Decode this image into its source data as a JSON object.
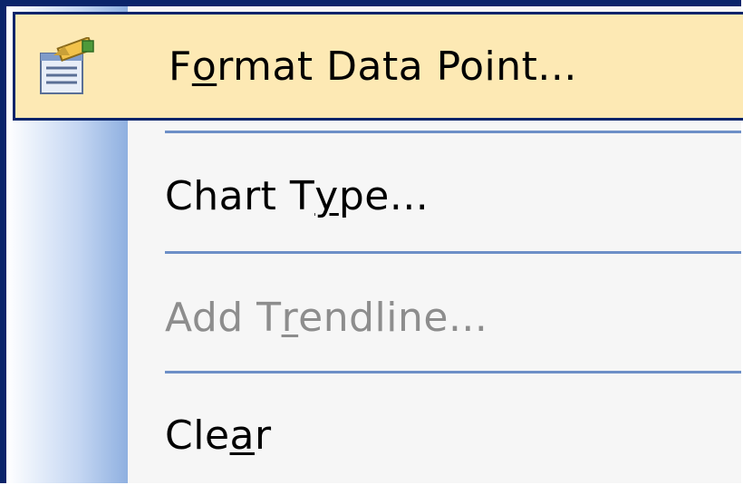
{
  "menu": {
    "items": [
      {
        "pre": "F",
        "ul": "o",
        "post": "rmat Data Point...",
        "enabled": true,
        "highlighted": true,
        "icon": "format-data-point-icon"
      },
      {
        "pre": "Chart T",
        "ul": "y",
        "post": "pe...",
        "enabled": true
      },
      {
        "pre": "Add T",
        "ul": "r",
        "post": "endline...",
        "enabled": false
      },
      {
        "pre": "Cle",
        "ul": "a",
        "post": "r",
        "enabled": true
      }
    ]
  },
  "colors": {
    "highlight_bg": "#fde9b4",
    "highlight_border": "#0a246a",
    "separator": "#6d8fc7",
    "disabled_text": "#8d8d8d"
  }
}
